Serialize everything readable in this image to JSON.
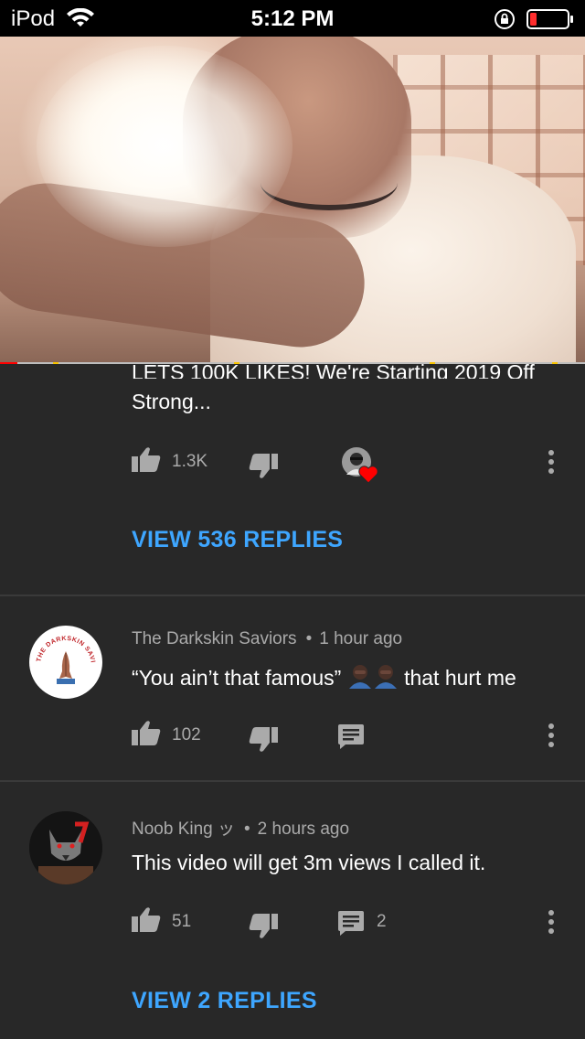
{
  "status_bar": {
    "carrier": "iPod",
    "time": "5:12 PM"
  },
  "video": {
    "progress_fraction": 0.03
  },
  "comments": [
    {
      "text_line1": "LETS 100K LIKES! We're Starting 2019 Off",
      "text_line2": "Strong...",
      "likes": "1.3K",
      "view_replies": "VIEW 536 REPLIES"
    },
    {
      "author": "The Darkskin Saviors",
      "separator": "•",
      "time": "1 hour ago",
      "text_before": "“You ain’t that famous”",
      "text_after": " that hurt me",
      "likes": "102",
      "avatar_caption": "THE DARKSKIN SAVIORS"
    },
    {
      "author": "Noob King ッ",
      "separator": "•",
      "time": "2 hours ago",
      "text": "This video will get 3m views I called it.",
      "likes": "51",
      "replies_count": "2",
      "view_replies": "VIEW 2 REPLIES"
    }
  ],
  "colors": {
    "background": "#282828",
    "link_blue": "#3ea6ff",
    "muted_text": "#aaaaaa",
    "progress_red": "#ff0000",
    "heart_red": "#ff0000"
  },
  "icons": {
    "like": "thumbs-up-icon",
    "dislike": "thumbs-down-icon",
    "reply": "comment-icon",
    "menu": "vertical-dots-icon",
    "creator_heart": "heart-icon",
    "wifi": "wifi-icon",
    "rotation_lock": "rotation-lock-icon",
    "battery": "battery-icon"
  }
}
